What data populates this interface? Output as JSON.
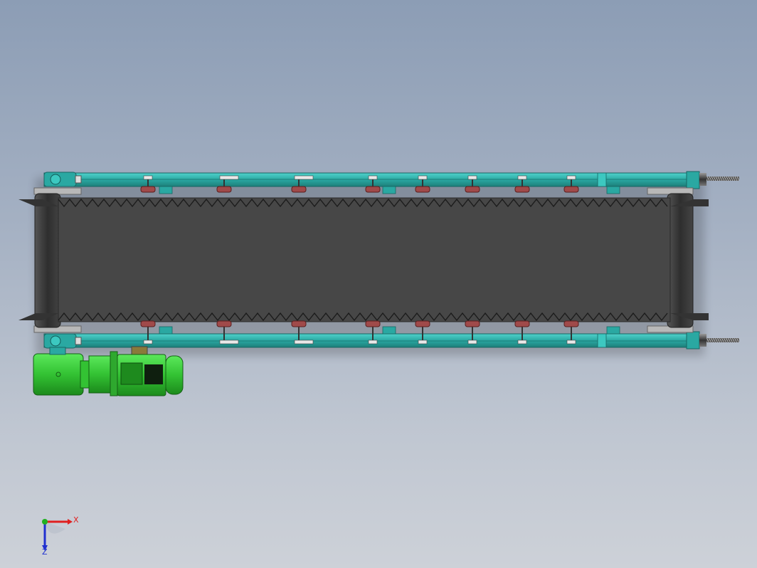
{
  "viewport": {
    "name": "cad-graphics-area",
    "colors": {
      "frame": "#2fb7b0",
      "frame_dark": "#1f8682",
      "belt": "#444444",
      "roller": "#3c3c3c",
      "motor": "#3dd23d",
      "motor_dark": "#1f8f1f",
      "idler_brackets": "#a04a4a",
      "screw": "#4a4a4a"
    }
  },
  "model": {
    "type": "belt-conveyor",
    "idler_count_per_side": 8,
    "cleats": "chevron-sidewall"
  },
  "triad": {
    "x_label": "X",
    "z_label": "Z",
    "x_color": "#e02020",
    "y_color": "#20b020",
    "z_color": "#2030d0"
  }
}
